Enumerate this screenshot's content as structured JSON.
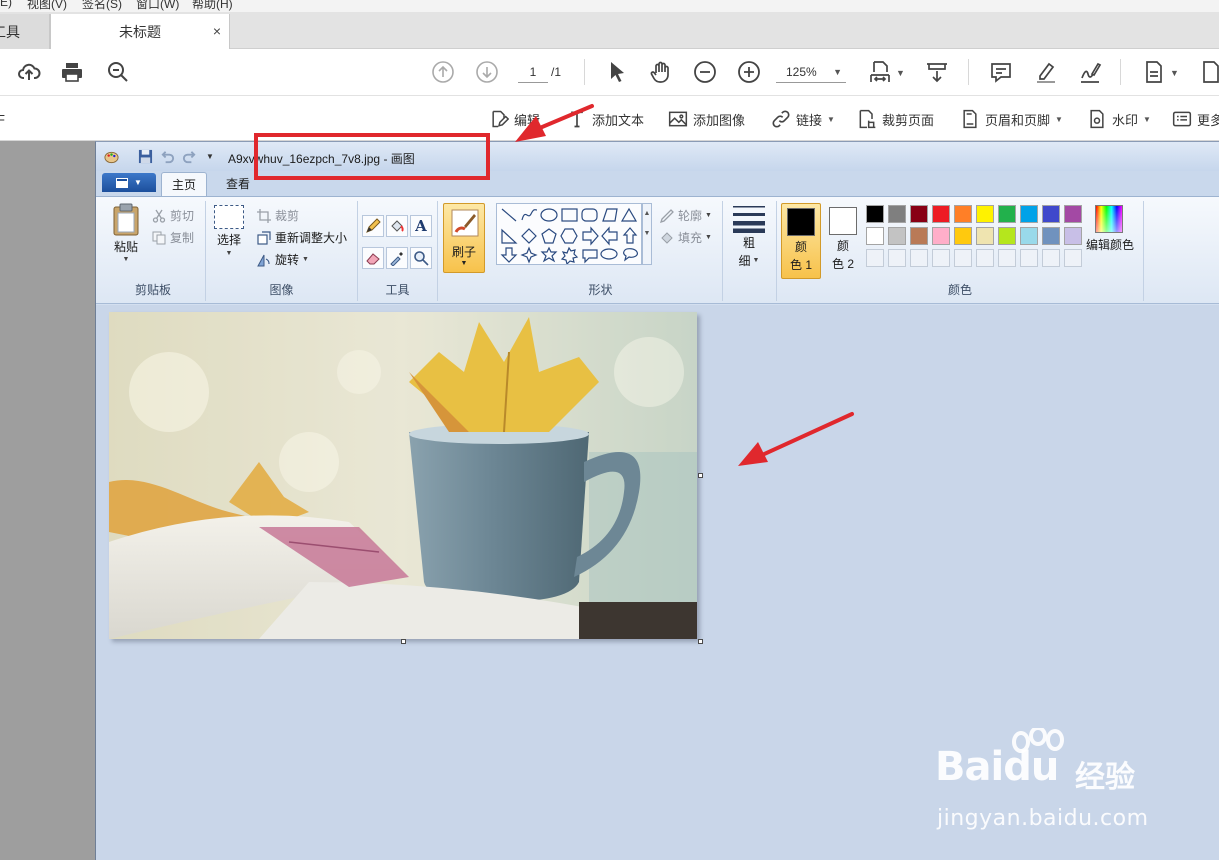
{
  "menubar": {
    "items": [
      "(E)",
      "视图(V)",
      "签名(S)",
      "窗口(W)",
      "帮助(H)"
    ]
  },
  "tabs": {
    "tools_label": "工具",
    "document_label": "未标题",
    "close_glyph": "×"
  },
  "toolbar": {
    "icons": [
      "upload-icon",
      "print-icon",
      "search-icon",
      "prev-page-icon",
      "next-page-icon",
      "select-pointer-icon",
      "hand-pan-icon",
      "zoom-out-icon",
      "zoom-in-icon",
      "fit-page-icon",
      "scroll-mode-icon",
      "comment-icon",
      "highlight-icon",
      "sign-icon",
      "page-view-icon"
    ],
    "page_current": "1",
    "page_total": "/1",
    "zoom_value": "125%"
  },
  "edit_toolbar": {
    "left_fragment": "F",
    "edit_label": "编辑",
    "add_text_label": "添加文本",
    "add_image_label": "添加图像",
    "link_label": "链接",
    "crop_label": "裁剪页面",
    "header_footer_label": "页眉和页脚",
    "watermark_label": "水印",
    "more_label": "更多"
  },
  "paint": {
    "title": "A9xvwhuv_16ezpch_7v8.jpg - 画图",
    "tab_home": "主页",
    "tab_view": "查看",
    "clipboard": {
      "group_label": "剪贴板",
      "paste": "粘贴",
      "cut": "剪切",
      "copy": "复制"
    },
    "image": {
      "group_label": "图像",
      "select": "选择",
      "crop": "裁剪",
      "resize": "重新调整大小",
      "rotate": "旋转"
    },
    "tools": {
      "group_label": "工具"
    },
    "brushes": {
      "label": "刷子"
    },
    "shapes": {
      "group_label": "形状",
      "outline": "轮廓",
      "fill": "填充"
    },
    "size": {
      "line1": "粗",
      "line2": "细"
    },
    "colors": {
      "group_label": "颜色",
      "color1_line1": "颜",
      "color1_line2": "色 1",
      "color2_line1": "颜",
      "color2_line2": "色 2",
      "color1_value": "#000000",
      "color2_value": "#ffffff",
      "edit_colors": "编辑颜色",
      "palette_row1": [
        "#000000",
        "#7f7f7f",
        "#880015",
        "#ed1c24",
        "#ff7f27",
        "#fff200",
        "#22b14c",
        "#00a2e8",
        "#3f48cc",
        "#a349a4"
      ],
      "palette_row2": [
        "#ffffff",
        "#c3c3c3",
        "#b97a57",
        "#ffaec9",
        "#ffc90e",
        "#efe4b0",
        "#b5e61d",
        "#99d9ea",
        "#7092be",
        "#c8bfe7"
      ]
    }
  },
  "watermark": {
    "brand": "Bai",
    "brand2": "du",
    "cn": "经验",
    "url": "jingyan.baidu.com"
  }
}
